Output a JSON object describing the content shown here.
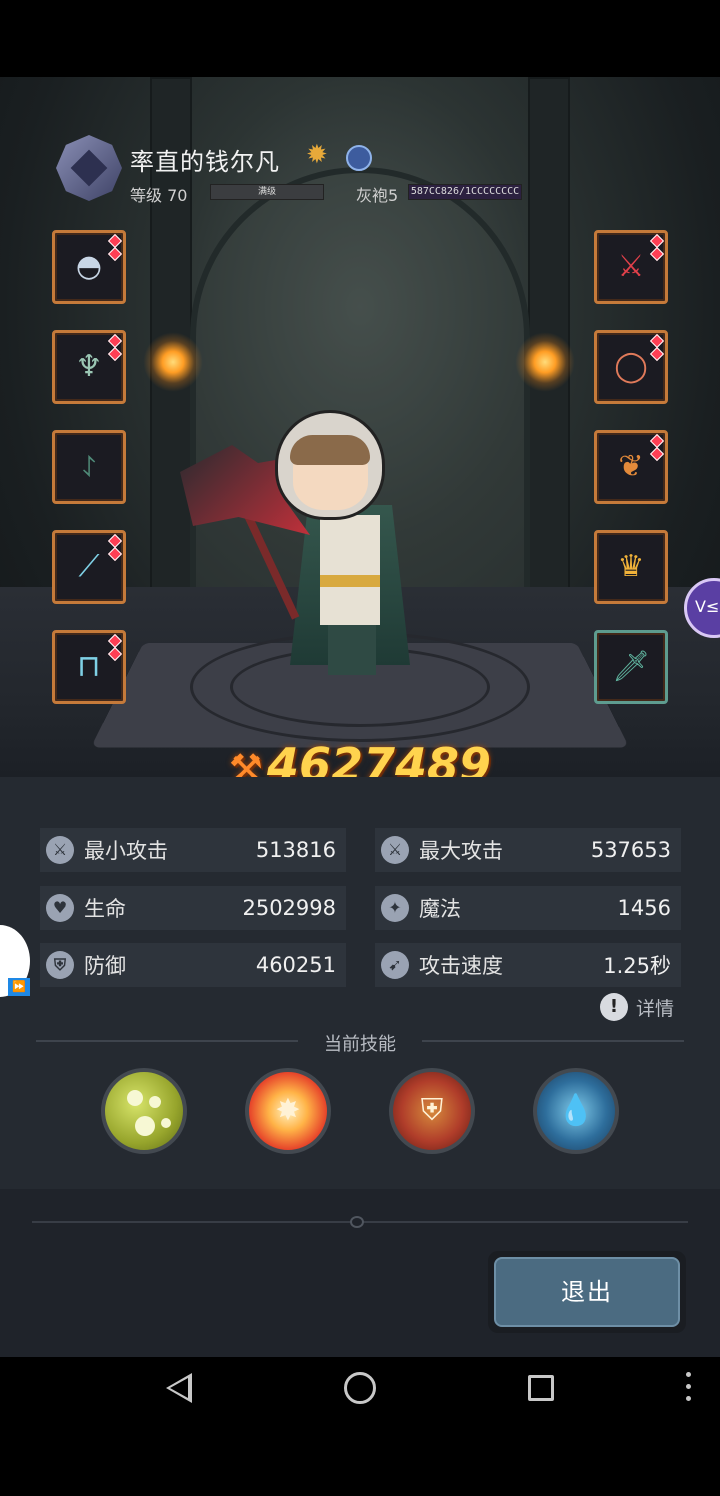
{
  "header": {
    "player_name": "率直的钱尔凡",
    "level_label": "等级 70",
    "level_bar_text": "满级",
    "rank_label": "灰袍5",
    "exp_text": "587CC826/1CCCCCCCC"
  },
  "equipment": {
    "left": [
      {
        "icon": "hood-icon",
        "glyph": "◓"
      },
      {
        "icon": "armor-icon",
        "glyph": "♆"
      },
      {
        "icon": "boots-icon",
        "glyph": "⥌"
      },
      {
        "icon": "bracer-icon",
        "glyph": "⟋"
      },
      {
        "icon": "pants-icon",
        "glyph": "⊓"
      }
    ],
    "right": [
      {
        "icon": "axe-icon",
        "glyph": "⚔"
      },
      {
        "icon": "ring-icon",
        "glyph": "◯"
      },
      {
        "icon": "necklace-icon",
        "glyph": "❦"
      },
      {
        "icon": "crown-icon",
        "glyph": "♛"
      },
      {
        "icon": "dagger-icon",
        "glyph": "🗡"
      }
    ]
  },
  "side_orb_text": "V≤",
  "combat_power": "4627489",
  "stats": [
    {
      "name": "最小攻击",
      "value": "513816",
      "icon": "sword-icon",
      "glyph": "⚔"
    },
    {
      "name": "最大攻击",
      "value": "537653",
      "icon": "sword-icon",
      "glyph": "⚔"
    },
    {
      "name": "生命",
      "value": "2502998",
      "icon": "heart-icon",
      "glyph": "♥"
    },
    {
      "name": "魔法",
      "value": "1456",
      "icon": "magic-icon",
      "glyph": "✦"
    },
    {
      "name": "防御",
      "value": "460251",
      "icon": "shield-icon",
      "glyph": "⛨"
    },
    {
      "name": "攻击速度",
      "value": "1.25秒",
      "icon": "speed-icon",
      "glyph": "➹"
    }
  ],
  "detail_label": "详情",
  "skills_title": "当前技能",
  "skills": [
    {
      "icon": "poison-skill-icon"
    },
    {
      "icon": "explosion-skill-icon"
    },
    {
      "icon": "fire-shield-skill-icon"
    },
    {
      "icon": "water-shield-skill-icon"
    }
  ],
  "exit_label": "退出",
  "colors": {
    "accent_gold": "#ffd34e",
    "slot_border": "#c57a3a",
    "panel_bg": "#252a31",
    "button_bg": "#4b6b81"
  }
}
